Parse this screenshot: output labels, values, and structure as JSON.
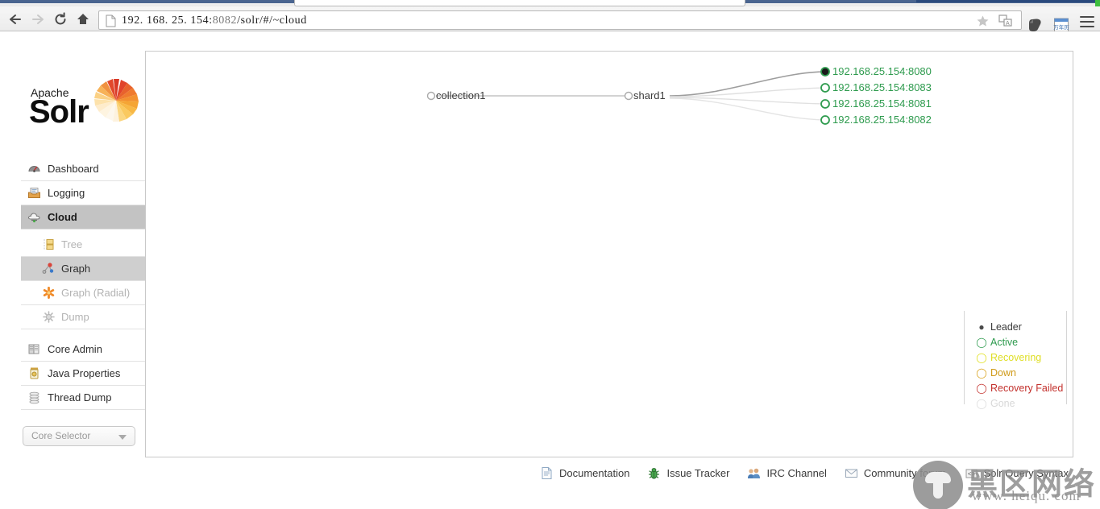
{
  "browser": {
    "nav": {
      "back": "back-arrow",
      "forward": "forward-arrow",
      "reload": "reload",
      "home": "home"
    },
    "url_prefix": "192. 168. 25. 154:",
    "url_port": "8082",
    "url_suffix": "/solr/#/~cloud",
    "url_full": "192. 168. 25. 154:8082/solr/#/~cloud",
    "star_icon": "☆",
    "icons": [
      "star-icon",
      "translate-icon",
      "evernote-icon",
      "calendar-icon",
      "menu-icon"
    ]
  },
  "logo": {
    "apache": "Apache",
    "solr": "Solr"
  },
  "sidebar": {
    "items": [
      {
        "label": "Dashboard",
        "icon": "dashboard-icon",
        "active": false
      },
      {
        "label": "Logging",
        "icon": "logging-icon",
        "active": false
      },
      {
        "label": "Cloud",
        "icon": "cloud-icon",
        "active": true
      }
    ],
    "subitems": [
      {
        "label": "Tree",
        "icon": "tree-icon",
        "selected": false
      },
      {
        "label": "Graph",
        "icon": "graph-icon",
        "selected": true
      },
      {
        "label": "Graph (Radial)",
        "icon": "graph-radial-icon",
        "selected": false
      },
      {
        "label": "Dump",
        "icon": "dump-icon",
        "selected": false
      }
    ],
    "items2": [
      {
        "label": "Core Admin",
        "icon": "core-admin-icon"
      },
      {
        "label": "Java Properties",
        "icon": "java-properties-icon"
      },
      {
        "label": "Thread Dump",
        "icon": "thread-dump-icon"
      }
    ],
    "core_selector": {
      "placeholder": "Core Selector",
      "arrow": "chevron-down-icon"
    }
  },
  "graph": {
    "collection": {
      "label": "collection1",
      "state": "inactive"
    },
    "shard": {
      "label": "shard1",
      "state": "inactive"
    },
    "nodes": [
      {
        "label": "192.168.25.154:8080",
        "state": "leader",
        "color": "#2e9b4e"
      },
      {
        "label": "192.168.25.154:8083",
        "state": "active",
        "color": "#2e9b4e"
      },
      {
        "label": "192.168.25.154:8081",
        "state": "active",
        "color": "#2e9b4e"
      },
      {
        "label": "192.168.25.154:8082",
        "state": "active",
        "color": "#2e9b4e"
      }
    ]
  },
  "legend": {
    "rows": [
      {
        "label": "Leader",
        "color": "#4a4a4a",
        "text_color": "#3a3a3a",
        "mark": "●"
      },
      {
        "label": "Active",
        "color": "#2e9b4e",
        "text_color": "#2e9b4e",
        "mark": "◯"
      },
      {
        "label": "Recovering",
        "color": "#e0e01e",
        "text_color": "#dede24",
        "mark": "◯"
      },
      {
        "label": "Down",
        "color": "#d9a21b",
        "text_color": "#cf9a18",
        "mark": "◯"
      },
      {
        "label": "Recovery Failed",
        "color": "#c3302c",
        "text_color": "#c3302c",
        "mark": "◯"
      },
      {
        "label": "Gone",
        "color": "#dcdcdc",
        "text_color": "#d8d8d8",
        "mark": "◯"
      }
    ]
  },
  "footer": {
    "links": [
      {
        "label": "Documentation",
        "icon": "document-icon"
      },
      {
        "label": "Issue Tracker",
        "icon": "bug-icon"
      },
      {
        "label": "IRC Channel",
        "icon": "people-icon"
      },
      {
        "label": "Community forum",
        "icon": "mail-icon"
      },
      {
        "label": "Solr Query Syntax",
        "icon": "code-icon"
      }
    ]
  },
  "watermark": {
    "chinese": "黑区网络",
    "url": "www. heiqu. com"
  }
}
